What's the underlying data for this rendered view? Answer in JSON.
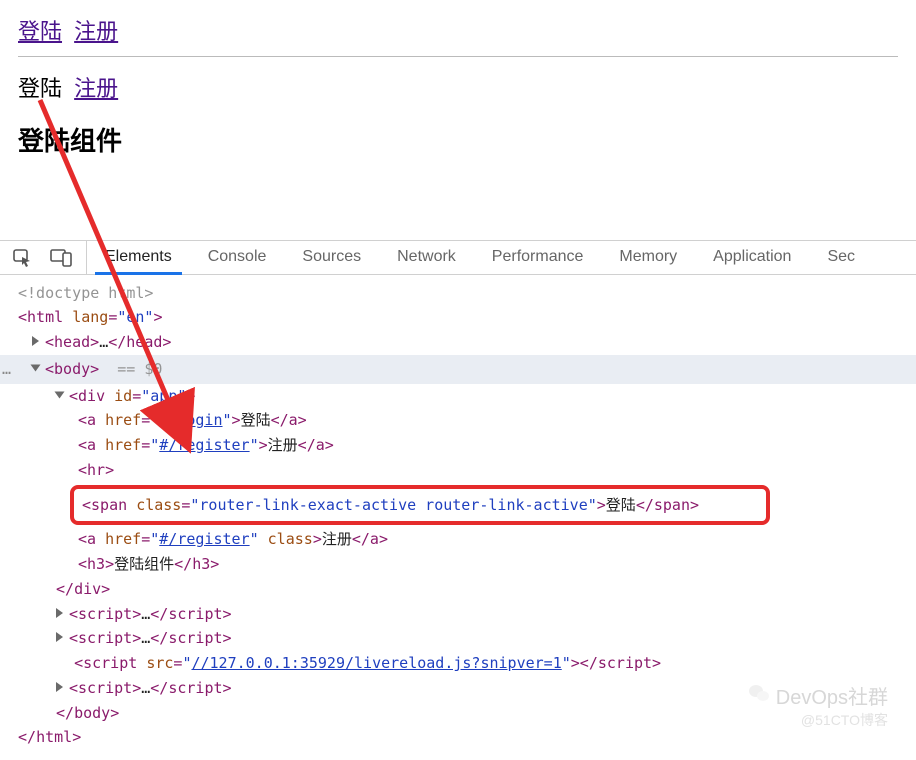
{
  "page": {
    "links_top": {
      "login": "登陆",
      "register": "注册"
    },
    "links_mid": {
      "login": "登陆",
      "register": "注册"
    },
    "heading": "登陆组件"
  },
  "devtools": {
    "tabs": {
      "elements": "Elements",
      "console": "Console",
      "sources": "Sources",
      "network": "Network",
      "performance": "Performance",
      "memory": "Memory",
      "application": "Application",
      "security": "Sec"
    },
    "icons": {
      "inspect": "inspect-icon",
      "device": "device-icon"
    }
  },
  "dom": {
    "doctype": "<!doctype html>",
    "html_open": "html",
    "html_lang_attr": "lang",
    "html_lang_val": "\"en\"",
    "head": {
      "open": "head",
      "ellipsis": "…",
      "close": "head"
    },
    "body_open": "body",
    "body_hint": "== $0",
    "div_open": "div",
    "div_id_attr": "id",
    "div_id_val": "\"app\"",
    "a1": {
      "tag": "a",
      "href_attr": "href",
      "href_val_prefix": "\"",
      "href_val_link": "#/login",
      "href_val_suffix": "\"",
      "text": "登陆"
    },
    "a2": {
      "tag": "a",
      "href_attr": "href",
      "href_val_prefix": "\"",
      "href_val_link": "#/register",
      "href_val_suffix": "\"",
      "text": "注册"
    },
    "hr": "hr",
    "highlight": {
      "tag": "span",
      "class_attr": "class",
      "class_val": "\"router-link-exact-active router-link-active\"",
      "text": "登陆"
    },
    "a3": {
      "tag": "a",
      "href_attr": "href",
      "href_val_prefix": "\"",
      "href_val_link": "#/register",
      "href_val_suffix": "\"",
      "class_attr": "class",
      "text": "注册"
    },
    "h3": {
      "tag": "h3",
      "text": "登陆组件"
    },
    "div_close": "div",
    "script1": {
      "tag": "script",
      "ellipsis": "…"
    },
    "script2": {
      "tag": "script",
      "ellipsis": "…"
    },
    "script_src": {
      "tag": "script",
      "src_attr": "src",
      "src_val_prefix": "\"",
      "src_val_link": "//127.0.0.1:35929/livereload.js?snipver=1",
      "src_val_suffix": "\""
    },
    "script3": {
      "tag": "script",
      "ellipsis": "…"
    },
    "body_close": "body",
    "html_close": "html"
  },
  "watermark": {
    "line1": "DevOps社群",
    "line2": "@51CTO博客"
  }
}
